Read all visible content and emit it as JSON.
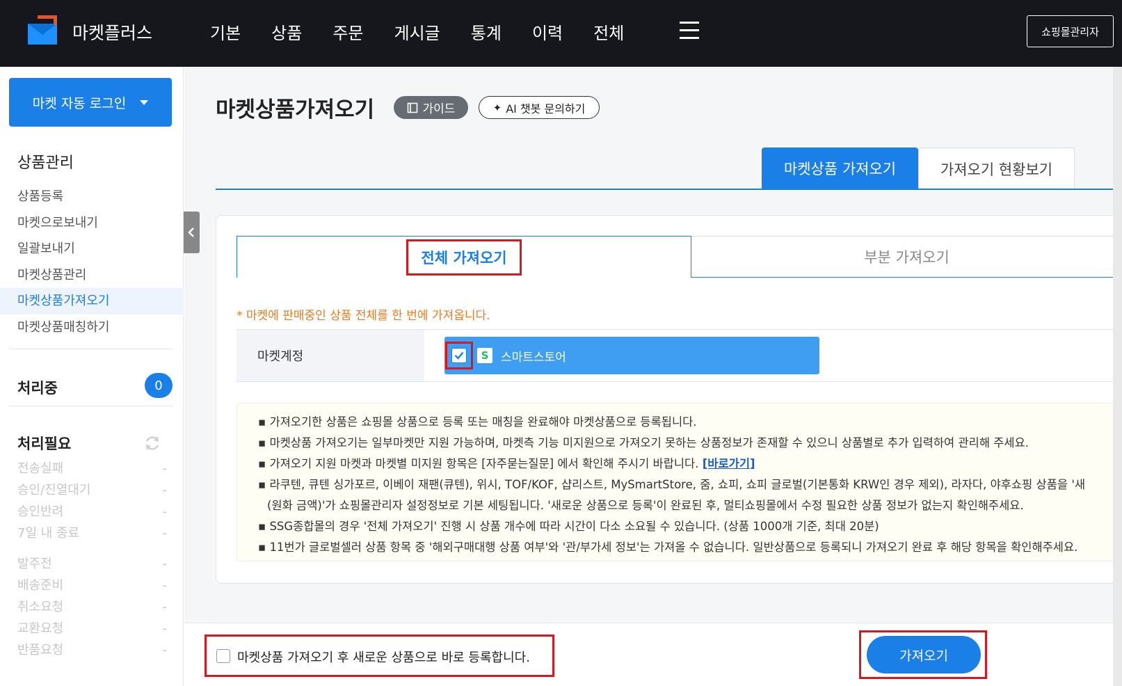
{
  "header": {
    "brand": "마켓플러스",
    "nav": [
      "기본",
      "상품",
      "주문",
      "게시글",
      "통계",
      "이력",
      "전체"
    ],
    "admin_button": "쇼핑몰관리자"
  },
  "sidebar": {
    "auto_login": "마켓 자동 로그인",
    "section_title": "상품관리",
    "menu": [
      "상품등록",
      "마켓으로보내기",
      "일괄보내기",
      "마켓상품관리",
      "마켓상품가져오기",
      "마켓상품매칭하기"
    ],
    "active_menu": "마켓상품가져오기",
    "processing": {
      "label": "처리중",
      "count": "0"
    },
    "needed": {
      "label": "처리필요",
      "group1": [
        {
          "label": "전송실패",
          "value": "-"
        },
        {
          "label": "승인/진열대기",
          "value": "-"
        },
        {
          "label": "승인반려",
          "value": "-"
        },
        {
          "label": "7일 내 종료",
          "value": "-"
        }
      ],
      "group2": [
        {
          "label": "발주전",
          "value": "-"
        },
        {
          "label": "배송준비",
          "value": "-"
        },
        {
          "label": "취소요청",
          "value": "-"
        },
        {
          "label": "교환요청",
          "value": "-"
        },
        {
          "label": "반품요청",
          "value": "-"
        }
      ]
    }
  },
  "main": {
    "title": "마켓상품가져오기",
    "guide_button": "가이드",
    "ai_button": "AI 챗봇 문의하기",
    "tabs": [
      "마켓상품 가져오기",
      "가져오기 현황보기"
    ],
    "sub_tabs": [
      "전체 가져오기",
      "부분 가져오기"
    ],
    "notice": "* 마켓에 판매중인 상품 전체를 한 번에 가져옵니다.",
    "account_label": "마켓계정",
    "account_name": "스마트스토어",
    "account_icon": "S",
    "info_lines": [
      "가져오기한 상품은 쇼핑몰 상품으로 등록 또는 매칭을 완료해야 마켓상품으로 등록됩니다.",
      "마켓상품 가져오기는 일부마켓만 지원 가능하며, 마켓측 기능 미지원으로 가져오기 못하는 상품정보가 존재할 수 있으니 상품별로 추가 입력하여 관리해 주세요.",
      "가져오기 지원 마켓과 마켓별 미지원 항목은 [자주묻는질문] 에서 확인해 주시기 바랍니다. ",
      "라쿠텐, 큐텐 싱가포르, 이베이 재팬(큐텐), 위시, TOF/KOF, 샵리스트, MySmartStore, 줌, 쇼피, 쇼피 글로벌(기본통화 KRW인 경우 제외), 라자다, 야후쇼핑 상품을 '새",
      "(원화 금액)'가 쇼핑몰관리자 설정정보로 기본 세팅됩니다. '새로운 상품으로 등록'이 완료된 후, 멀티쇼핑몰에서 수정 필요한 상품 정보가 없는지 확인해주세요.",
      "SSG종합몰의 경우 '전체 가져오기' 진행 시 상품 개수에 따라 시간이 다소 소요될 수 있습니다. (상품 1000개 기준, 최대 20분)",
      "11번가 글로벌셀러 상품 항목 중 '해외구매대행 상품 여부'와 '관/부가세 정보'는 가져올 수 없습니다. 일반상품으로 등록되니 가져오기 완료 후 해당 항목을 확인해주세요."
    ],
    "link_text": "[바로가기]"
  },
  "footer": {
    "register_label": "마켓상품 가져오기 후 새로운 상품으로 바로 등록합니다.",
    "import_button": "가져오기"
  },
  "colors": {
    "accent": "#1a7fe6",
    "highlight": "#d8181f",
    "notice": "#f07a1f",
    "topbar": "#15171c"
  },
  "icons": [
    "logo-icon",
    "hamburger-icon",
    "caret-down-icon",
    "refresh-icon",
    "chevron-left-icon",
    "book-icon",
    "sparkle-icon",
    "checkbox-checked-icon",
    "smartstore-icon"
  ]
}
